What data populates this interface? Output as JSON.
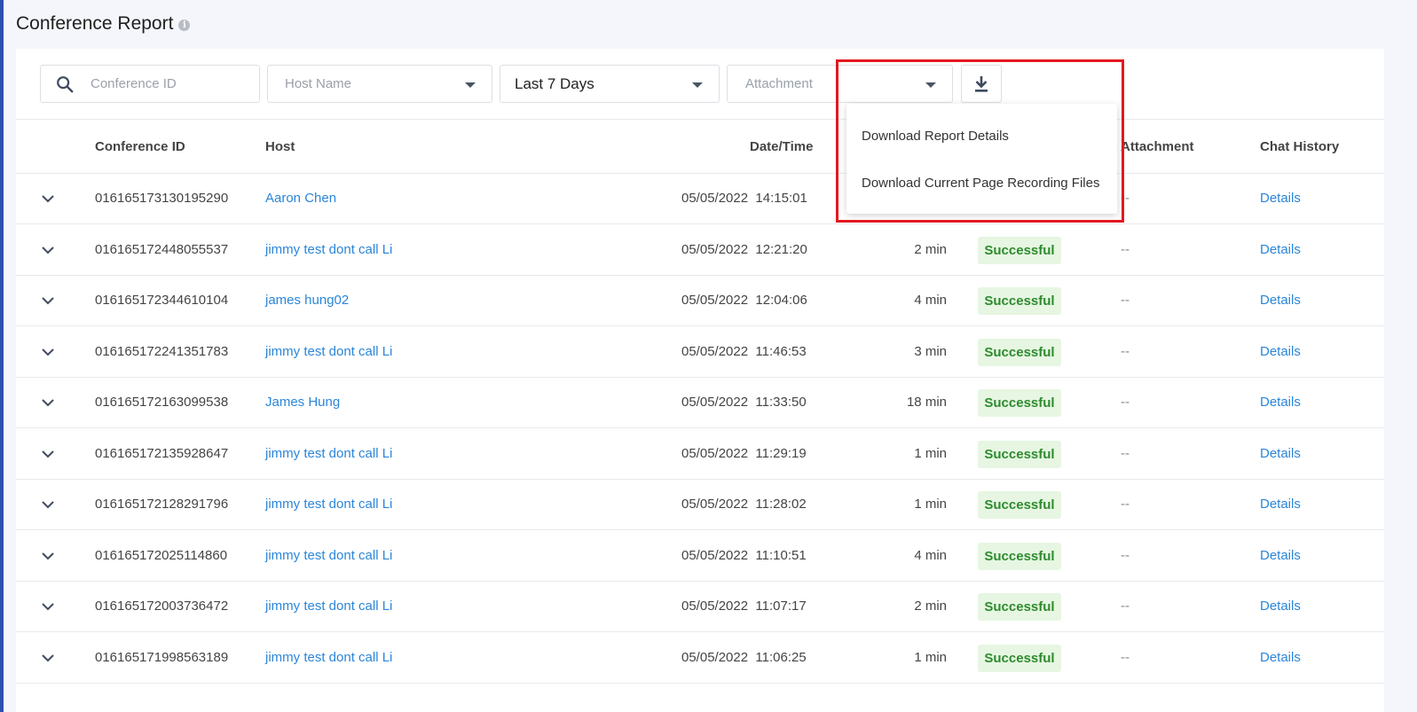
{
  "page": {
    "title": "Conference Report"
  },
  "filters": {
    "conference_id_placeholder": "Conference ID",
    "host_name_placeholder": "Host Name",
    "date_range_value": "Last 7 Days",
    "attachment_placeholder": "Attachment"
  },
  "download_menu": {
    "items": [
      "Download Report Details",
      "Download Current Page Recording Files"
    ]
  },
  "table": {
    "columns": {
      "conference_id": "Conference ID",
      "host": "Host",
      "datetime": "Date/Time",
      "attachment": "Attachment",
      "chat_history": "Chat History"
    },
    "rows": [
      {
        "conference_id": "016165173130195290",
        "host": "Aaron Chen",
        "datetime": "05/05/2022  14:15:01",
        "duration": "",
        "status": "",
        "attachment": "--",
        "chat": "Details"
      },
      {
        "conference_id": "016165172448055537",
        "host": "jimmy test dont call Li",
        "datetime": "05/05/2022  12:21:20",
        "duration": "2 min",
        "status": "Successful",
        "attachment": "--",
        "chat": "Details"
      },
      {
        "conference_id": "016165172344610104",
        "host": "james hung02",
        "datetime": "05/05/2022  12:04:06",
        "duration": "4 min",
        "status": "Successful",
        "attachment": "--",
        "chat": "Details"
      },
      {
        "conference_id": "016165172241351783",
        "host": "jimmy test dont call Li",
        "datetime": "05/05/2022  11:46:53",
        "duration": "3 min",
        "status": "Successful",
        "attachment": "--",
        "chat": "Details"
      },
      {
        "conference_id": "016165172163099538",
        "host": "James Hung",
        "datetime": "05/05/2022  11:33:50",
        "duration": "18 min",
        "status": "Successful",
        "attachment": "--",
        "chat": "Details"
      },
      {
        "conference_id": "016165172135928647",
        "host": "jimmy test dont call Li",
        "datetime": "05/05/2022  11:29:19",
        "duration": "1 min",
        "status": "Successful",
        "attachment": "--",
        "chat": "Details"
      },
      {
        "conference_id": "016165172128291796",
        "host": "jimmy test dont call Li",
        "datetime": "05/05/2022  11:28:02",
        "duration": "1 min",
        "status": "Successful",
        "attachment": "--",
        "chat": "Details"
      },
      {
        "conference_id": "016165172025114860",
        "host": "jimmy test dont call Li",
        "datetime": "05/05/2022  11:10:51",
        "duration": "4 min",
        "status": "Successful",
        "attachment": "--",
        "chat": "Details"
      },
      {
        "conference_id": "016165172003736472",
        "host": "jimmy test dont call Li",
        "datetime": "05/05/2022  11:07:17",
        "duration": "2 min",
        "status": "Successful",
        "attachment": "--",
        "chat": "Details"
      },
      {
        "conference_id": "016165171998563189",
        "host": "jimmy test dont call Li",
        "datetime": "05/05/2022  11:06:25",
        "duration": "1 min",
        "status": "Successful",
        "attachment": "--",
        "chat": "Details"
      }
    ]
  },
  "colors": {
    "link": "#2b86d9",
    "success_text": "#2e8b2e",
    "success_bg": "#e6f6e2",
    "highlight": "#e2191f",
    "accent_strip": "#2f4fae"
  }
}
